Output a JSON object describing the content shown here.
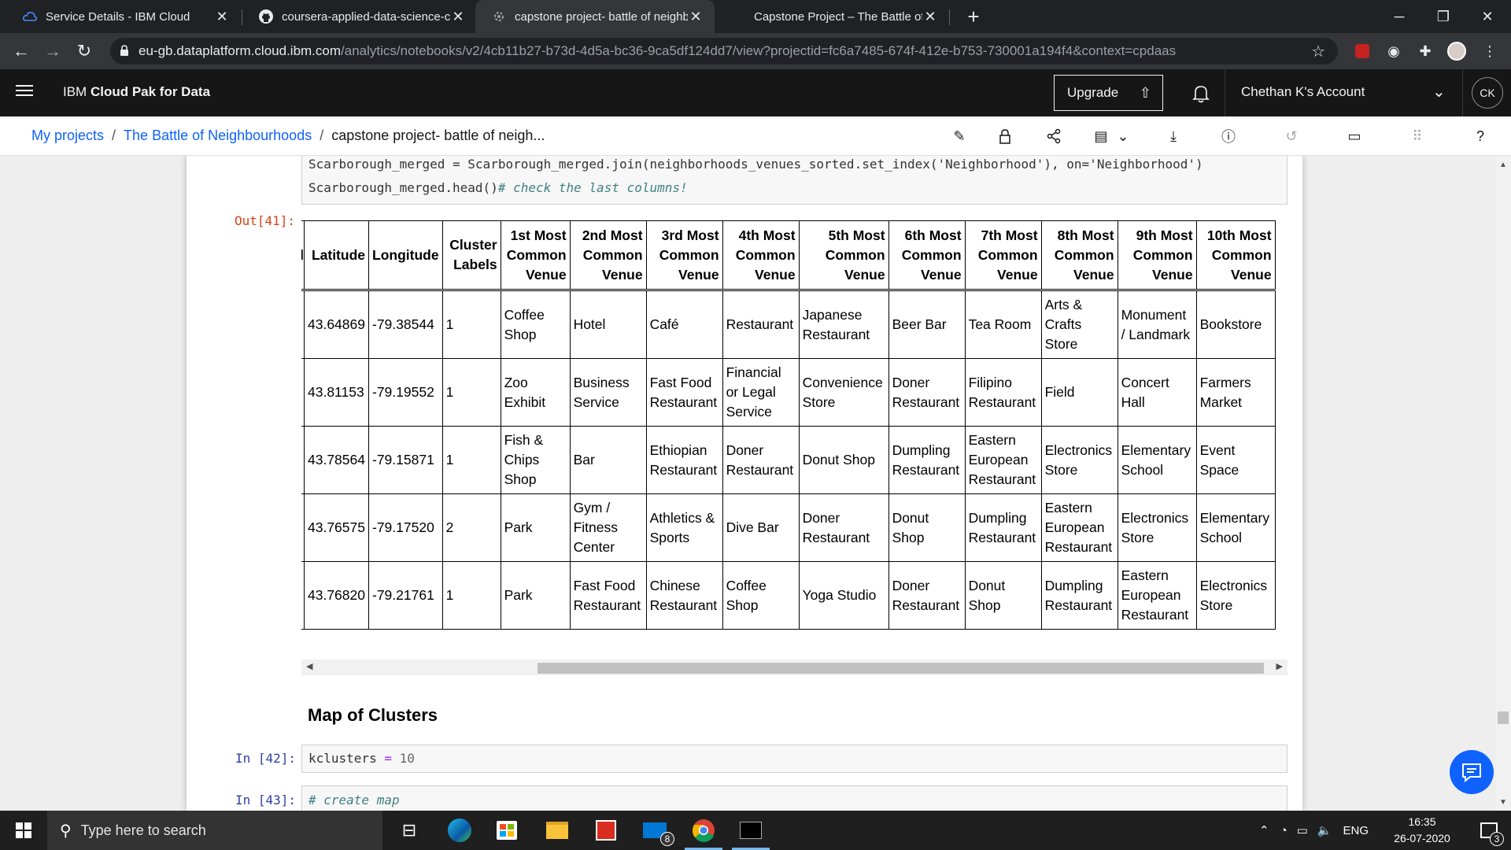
{
  "browser": {
    "tabs": [
      {
        "title": "Service Details - IBM Cloud",
        "icon": "ibm-cloud-icon",
        "active": false
      },
      {
        "title": "coursera-applied-data-science-capstone",
        "icon": "github-icon",
        "active": false
      },
      {
        "title": "capstone project- battle of neighbourhoods",
        "icon": "loading-icon",
        "active": true
      },
      {
        "title": "Capstone Project – The Battle of Neighbourhoods",
        "icon": "blank-icon",
        "active": false
      }
    ],
    "url_host": "eu-gb.dataplatform.cloud.ibm.com",
    "url_path": "/analytics/notebooks/v2/4cb11b27-b73d-4d5a-bc36-9ca5df124dd7/view?projectid=fc6a7485-674f-412e-b753-730001a194f4&context=cpdaas"
  },
  "header": {
    "brand_prefix": "IBM ",
    "brand_name": "Cloud Pak for Data",
    "upgrade_label": "Upgrade",
    "account_label": "Chethan K's Account",
    "avatar_initials": "CK"
  },
  "breadcrumb": {
    "items": [
      "My projects",
      "The Battle of Neighbourhoods"
    ],
    "separator": "/",
    "current": "capstone project- battle of neigh..."
  },
  "notebook": {
    "code_top_lines": [
      "Scarborough_merged = Scarborough_merged.join(neighborhoods_venues_sorted.set_index('Neighborhood'), on='Neighborhood')",
      "Scarborough_merged.head()",
      "# check the last columns!"
    ],
    "out_prompt": "Out[41]:",
    "table": {
      "columns": [
        "Latitude",
        "Longitude",
        "Cluster Labels",
        "1st Most Common Venue",
        "2nd Most Common Venue",
        "3rd Most Common Venue",
        "4th Most Common Venue",
        "5th Most Common Venue",
        "6th Most Common Venue",
        "7th Most Common Venue",
        "8th Most Common Venue",
        "9th Most Common Venue",
        "10th Most Common Venue"
      ],
      "rows": [
        [
          "43.64869",
          "-79.38544",
          "1",
          "Coffee Shop",
          "Hotel",
          "Café",
          "Restaurant",
          "Japanese Restaurant",
          "Beer Bar",
          "Tea Room",
          "Arts & Crafts Store",
          "Monument / Landmark",
          "Bookstore"
        ],
        [
          "43.81153",
          "-79.19552",
          "1",
          "Zoo Exhibit",
          "Business Service",
          "Fast Food Restaurant",
          "Financial or Legal Service",
          "Convenience Store",
          "Doner Restaurant",
          "Filipino Restaurant",
          "Field",
          "Concert Hall",
          "Farmers Market"
        ],
        [
          "43.78564",
          "-79.15871",
          "1",
          "Fish & Chips Shop",
          "Bar",
          "Ethiopian Restaurant",
          "Doner Restaurant",
          "Donut Shop",
          "Dumpling Restaurant",
          "Eastern European Restaurant",
          "Electronics Store",
          "Elementary School",
          "Event Space"
        ],
        [
          "43.76575",
          "-79.17520",
          "2",
          "Park",
          "Gym / Fitness Center",
          "Athletics & Sports",
          "Dive Bar",
          "Doner Restaurant",
          "Donut Shop",
          "Dumpling Restaurant",
          "Eastern European Restaurant",
          "Electronics Store",
          "Elementary School"
        ],
        [
          "43.76820",
          "-79.21761",
          "1",
          "Park",
          "Fast Food Restaurant",
          "Chinese Restaurant",
          "Coffee Shop",
          "Yoga Studio",
          "Doner Restaurant",
          "Donut Shop",
          "Dumpling Restaurant",
          "Eastern European Restaurant",
          "Electronics Store"
        ]
      ]
    },
    "markdown_heading": "Map of Clusters",
    "cell42_prompt": "In [42]:",
    "cell42_var": "kclusters",
    "cell42_op": "=",
    "cell42_value": "10",
    "cell43_prompt": "In [43]:",
    "cell43_comment": "# create map"
  },
  "taskbar": {
    "search_placeholder": "Type here to search",
    "mail_badge": "8",
    "language": "ENG",
    "time": "16:35",
    "date": "26-07-2020",
    "notification_count": "3"
  },
  "colors": {
    "ibm_header_bg": "#161616",
    "link_blue": "#0f62fe",
    "in_prompt": "#303f9f",
    "out_prompt": "#d84315"
  }
}
